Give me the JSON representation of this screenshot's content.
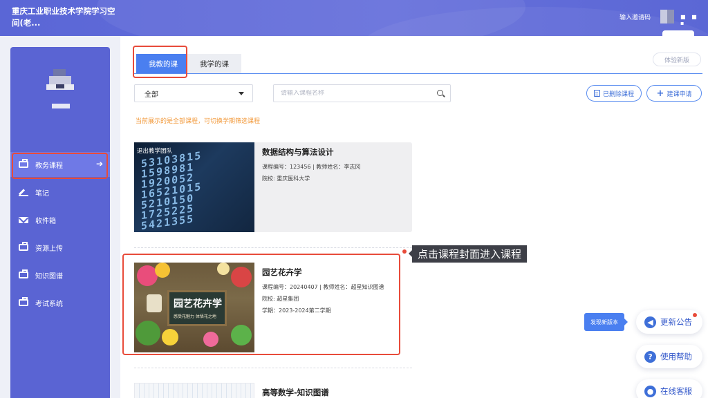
{
  "header": {
    "school_title": "重庆工业职业技术学院学习空间(老...",
    "invite_label": "输入邀请码",
    "more_dots": "■ ■ ▪"
  },
  "sidebar": {
    "items": [
      {
        "label": "教务课程",
        "icon": "briefcase-icon",
        "active": true
      },
      {
        "label": "笔记",
        "icon": "pen-icon",
        "active": false
      },
      {
        "label": "收件箱",
        "icon": "mail-icon",
        "active": false
      },
      {
        "label": "资源上传",
        "icon": "briefcase-icon",
        "active": false
      },
      {
        "label": "知识图谱",
        "icon": "briefcase-icon",
        "active": false
      },
      {
        "label": "考试系统",
        "icon": "briefcase-icon",
        "active": false
      }
    ],
    "active_arrow": "➔"
  },
  "tabs": [
    {
      "label": "我教的课",
      "active": true
    },
    {
      "label": "我学的课",
      "active": false
    }
  ],
  "try_new_label": "体验新版",
  "filter": {
    "selected": "全部",
    "search_placeholder": "请输入课程名称"
  },
  "actions": {
    "deleted_label": "已删除课程",
    "apply_label": "建课申请"
  },
  "hint_text": "当前展示的是全部课程，可切换学期筛选课程",
  "courses": [
    {
      "title": "数据结构与算法设计",
      "cover_tag": "退出教学团队",
      "code_line": "课程编号：123456 | 教师姓名：李志冈",
      "school_line": "院校: 重庆医科大学",
      "cover_digits": [
        "53103815",
        "1598981",
        "1920052",
        "16521015",
        "5210150",
        "1725225",
        "5421355"
      ]
    },
    {
      "title": "园艺花卉学",
      "code_line": "课程编号：20240407 | 教师姓名：超星知识图谱",
      "school_line": "院校: 超星集团",
      "term_line": "学期：2023-2024第二学期",
      "cover_title": "园艺花卉学",
      "cover_sub": "感受花魅力  体悟花之地"
    },
    {
      "title": "高等数学-知识图谱"
    }
  ],
  "callout_text": "点击课程封面进入课程",
  "floating": {
    "new_version": "发现新版本",
    "notice": "更新公告",
    "help": "使用帮助",
    "service": "在线客服",
    "help_glyph": "?",
    "notice_glyph": "◀",
    "service_glyph": "●"
  },
  "colors": {
    "primary": "#4a7ff0",
    "sidebar": "#5a64d3",
    "highlight": "#e84b3a",
    "hint": "#f29a3c"
  }
}
